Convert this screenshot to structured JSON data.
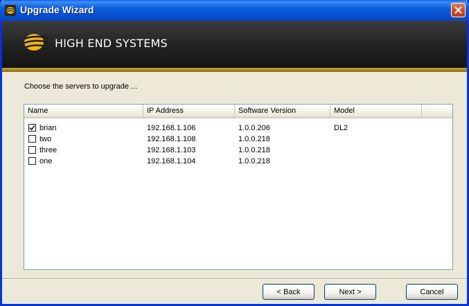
{
  "window": {
    "title": "Upgrade Wizard"
  },
  "banner": {
    "logo_text": "HIGH END SYSTEMS"
  },
  "instruction": "Choose the servers to upgrade ...",
  "list": {
    "columns": [
      "Name",
      "IP Address",
      "Software Version",
      "Model"
    ],
    "rows": [
      {
        "name": "brian",
        "ip": "192.168.1.106",
        "version": "1.0.0.206",
        "model": "DL2",
        "checked": true
      },
      {
        "name": "two",
        "ip": "192.168.1.108",
        "version": "1.0.0.218",
        "model": "",
        "checked": false
      },
      {
        "name": "three",
        "ip": "192.168.1.103",
        "version": "1.0.0.218",
        "model": "",
        "checked": false
      },
      {
        "name": "one",
        "ip": "192.168.1.104",
        "version": "1.0.0.218",
        "model": "",
        "checked": false
      }
    ]
  },
  "buttons": {
    "back": "< Back",
    "next": "Next >",
    "cancel": "Cancel"
  },
  "colors": {
    "titlebar": "#0a5ce8",
    "banner": "#1e1e1e",
    "accent_gold": "#c9a63a",
    "close": "#d34c26"
  }
}
